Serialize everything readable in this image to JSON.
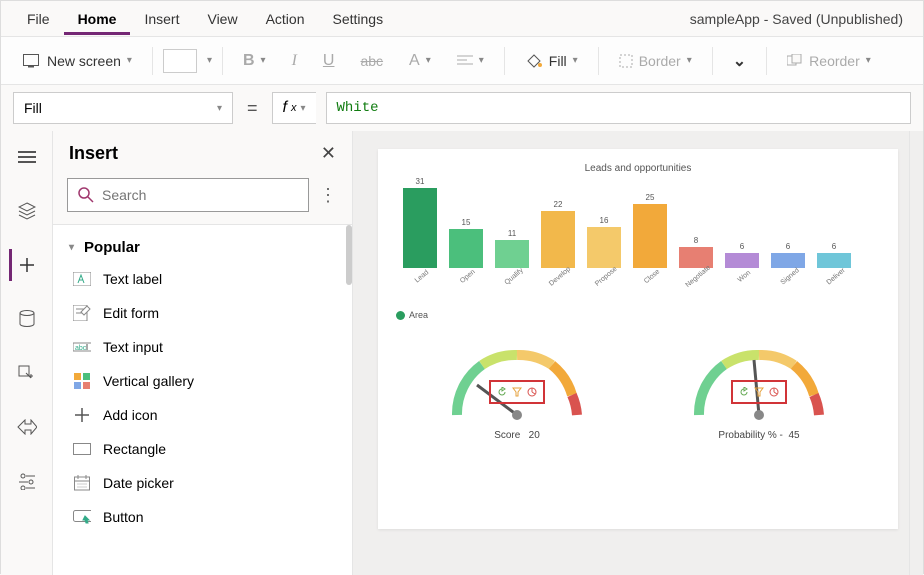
{
  "menu": {
    "items": [
      "File",
      "Home",
      "Insert",
      "View",
      "Action",
      "Settings"
    ],
    "active": "Home",
    "app_title": "sampleApp - Saved (Unpublished)"
  },
  "ribbon": {
    "new_screen": "New screen",
    "fill": "Fill",
    "border": "Border",
    "reorder": "Reorder"
  },
  "formula": {
    "property": "Fill",
    "value": "White"
  },
  "insert": {
    "title": "Insert",
    "search_placeholder": "Search",
    "group": "Popular",
    "items": [
      {
        "icon": "text-label",
        "label": "Text label"
      },
      {
        "icon": "edit-form",
        "label": "Edit form"
      },
      {
        "icon": "text-input",
        "label": "Text input"
      },
      {
        "icon": "vertical-gallery",
        "label": "Vertical gallery"
      },
      {
        "icon": "add-icon",
        "label": "Add icon"
      },
      {
        "icon": "rectangle",
        "label": "Rectangle"
      },
      {
        "icon": "date-picker",
        "label": "Date picker"
      },
      {
        "icon": "button",
        "label": "Button"
      }
    ]
  },
  "canvas": {
    "title": "Leads and opportunities",
    "legend": "Area",
    "gauge1": {
      "label": "Score",
      "value": "20"
    },
    "gauge2": {
      "label": "Probability % -",
      "value": "45"
    }
  },
  "chart_data": {
    "type": "bar",
    "title": "Leads and opportunities",
    "categories": [
      "Lead",
      "Open",
      "Qualify",
      "Develop",
      "Propose",
      "Close",
      "Negotiate",
      "Won",
      "Signed",
      "Deliver"
    ],
    "values": [
      31,
      15,
      11,
      22,
      16,
      25,
      8,
      6,
      6,
      6
    ],
    "colors": [
      "#2a9d5f",
      "#4bbf7c",
      "#6fd091",
      "#f2b84b",
      "#f4c96a",
      "#f2a93a",
      "#e77f72",
      "#b48bd6",
      "#7fa7e6",
      "#6fc6d9"
    ],
    "ylim": [
      0,
      35
    ],
    "legend": "Area"
  }
}
